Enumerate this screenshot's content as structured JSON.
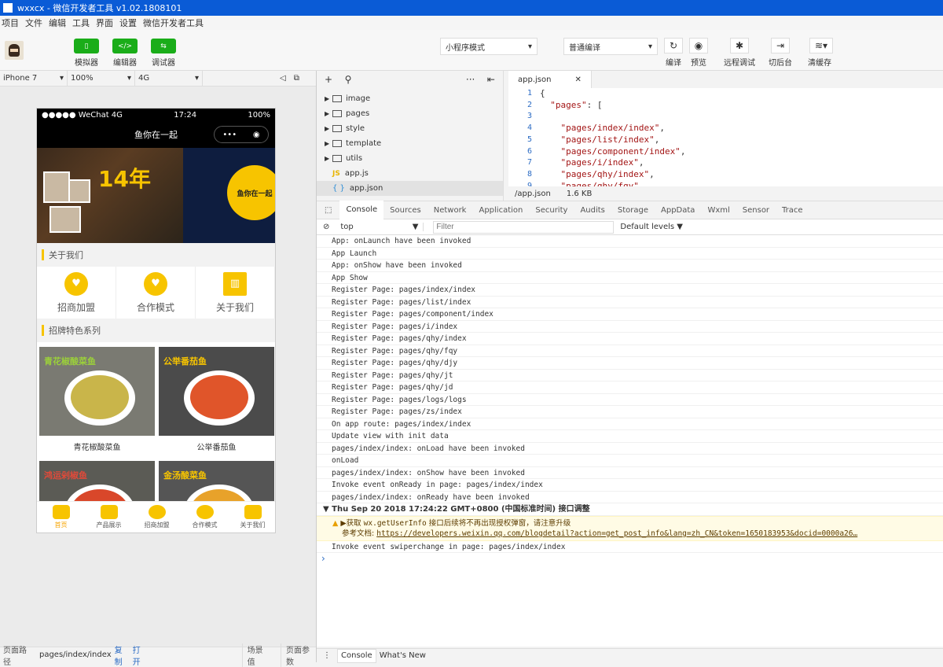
{
  "window": {
    "title": "wxxcx - 微信开发者工具 v1.02.1808101"
  },
  "menu": [
    "项目",
    "文件",
    "编辑",
    "工具",
    "界面",
    "设置",
    "微信开发者工具"
  ],
  "toolbar": {
    "simulator": "模拟器",
    "editor": "编辑器",
    "debugger": "调试器",
    "mode": "小程序模式",
    "compile_mode": "普通编译",
    "compile": "编译",
    "preview": "预览",
    "remote_debug": "远程调试",
    "background": "切后台",
    "clear_cache": "清缓存"
  },
  "sim": {
    "device": "iPhone 7",
    "zoom": "100%",
    "network": "4G"
  },
  "phone": {
    "carrier": "●●●●● WeChat 4G",
    "time": "17:24",
    "battery": "100%",
    "nav_title": "鱼你在一起",
    "banner_big": "14年",
    "banner_circle": "鱼你在一起",
    "section1": "关于我们",
    "grid": [
      "招商加盟",
      "合作模式",
      "关于我们"
    ],
    "section2": "招牌特色系列",
    "products": [
      {
        "name": "青花椒酸菜鱼",
        "tag": "青花椒酸菜鱼"
      },
      {
        "name": "公举番茄鱼",
        "tag": "公举番茄鱼"
      },
      {
        "name": "",
        "tag": "鸿运剁椒鱼"
      },
      {
        "name": "",
        "tag": "金汤酸菜鱼"
      }
    ],
    "tabs": [
      "首页",
      "产品展示",
      "招商加盟",
      "合作模式",
      "关于我们"
    ]
  },
  "sim_bottom": {
    "path_label": "页面路径",
    "path": "pages/index/index",
    "copy": "复制",
    "open": "打开",
    "scene": "场景值",
    "params": "页面参数"
  },
  "filetree": {
    "items": [
      {
        "name": "image",
        "type": "folder"
      },
      {
        "name": "pages",
        "type": "folder"
      },
      {
        "name": "style",
        "type": "folder"
      },
      {
        "name": "template",
        "type": "folder"
      },
      {
        "name": "utils",
        "type": "folder"
      },
      {
        "name": "app.js",
        "type": "js"
      },
      {
        "name": "app.json",
        "type": "json"
      }
    ]
  },
  "editor": {
    "tab": "app.json",
    "lines": [
      "1",
      "2",
      "3",
      "4",
      "5",
      "6",
      "7",
      "8",
      "9"
    ],
    "path": "/app.json",
    "size": "1.6 KB"
  },
  "devtools": {
    "tabs": [
      "Console",
      "Sources",
      "Network",
      "Application",
      "Security",
      "Audits",
      "Storage",
      "AppData",
      "Wxml",
      "Sensor",
      "Trace"
    ],
    "context": "top",
    "filter_placeholder": "Filter",
    "levels": "Default levels"
  },
  "console": {
    "lines": [
      "App: onLaunch have been invoked",
      "App Launch",
      "App: onShow have been invoked",
      "App Show",
      "Register Page: pages/index/index",
      "Register Page: pages/list/index",
      "Register Page: pages/component/index",
      "Register Page: pages/i/index",
      "Register Page: pages/qhy/index",
      "Register Page: pages/qhy/fqy",
      "Register Page: pages/qhy/djy",
      "Register Page: pages/qhy/jt",
      "Register Page: pages/qhy/jd",
      "Register Page: pages/logs/logs",
      "Register Page: pages/zs/index",
      "On app route: pages/index/index",
      "Update view with init data",
      "pages/index/index: onLoad have been invoked",
      "onLoad",
      "pages/index/index: onShow have been invoked",
      "Invoke event onReady in page: pages/index/index",
      "pages/index/index: onReady have been invoked"
    ],
    "group": "Thu Sep 20 2018 17:24:22 GMT+0800 (中国标准时间) 接口调整",
    "warn1_prefix": "▶获取 ",
    "warn1_code": "wx.getUserInfo",
    "warn1_text": " 接口后续将不再出现授权弹窗，请注意升级",
    "warn2_prefix": "参考文档: ",
    "warn2_link": "https://developers.weixin.qq.com/blogdetail?action=get_post_info&lang=zh_CN&token=1650183953&docid=0000a26…",
    "last": "Invoke event swiperchange in page: pages/index/index"
  },
  "console_bottom": {
    "tabs": [
      "Console",
      "What's New"
    ]
  }
}
